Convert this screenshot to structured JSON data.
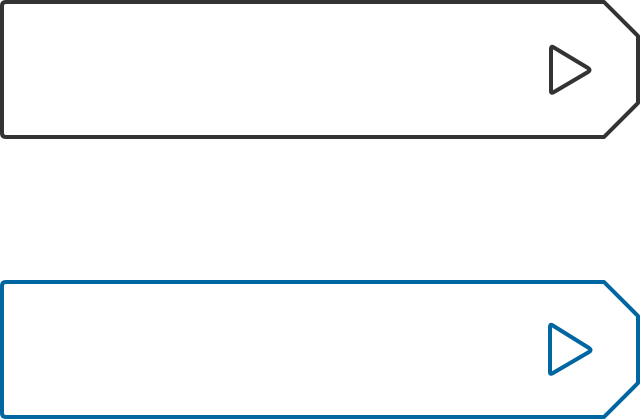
{
  "buttons": [
    {
      "state": "default",
      "color": "#333333",
      "icon": "play-icon"
    },
    {
      "state": "selected",
      "color": "#0066a1",
      "icon": "play-icon"
    }
  ]
}
